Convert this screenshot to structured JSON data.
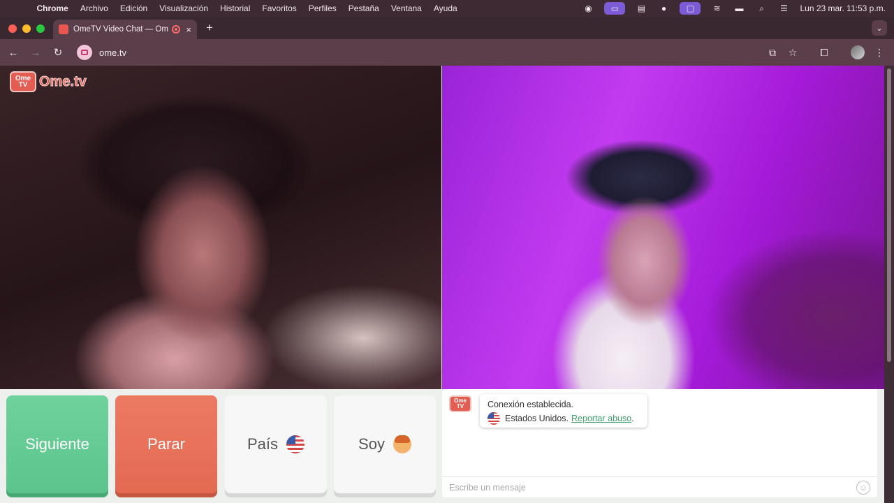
{
  "menubar": {
    "app": "Chrome",
    "items": [
      "Archivo",
      "Edición",
      "Visualización",
      "Historial",
      "Favoritos",
      "Perfiles",
      "Pestaña",
      "Ventana",
      "Ayuda"
    ],
    "clock": "Lun 23 mar.  11:53 p.m."
  },
  "browser": {
    "tab_title": "OmeTV Video Chat — Om",
    "tab_close": "×",
    "new_tab": "+",
    "url": "ome.tv"
  },
  "page": {
    "logo_tv": "Ome TV",
    "logo_text": "Ome.tv",
    "buttons": {
      "next": "Siguiente",
      "stop": "Parar",
      "country": "País",
      "gender": "Soy"
    },
    "chat": {
      "logo": "Ome TV",
      "status": "Conexión establecida.",
      "country": "Estados Unidos.",
      "report": "Reportar abuso",
      "period": ".",
      "input_placeholder": "Escribe un mensaje"
    }
  },
  "colors": {
    "next_button": "#5cc48c",
    "stop_button": "#e46a52",
    "brand": "#e35d52",
    "report_link": "#3fa06d"
  }
}
